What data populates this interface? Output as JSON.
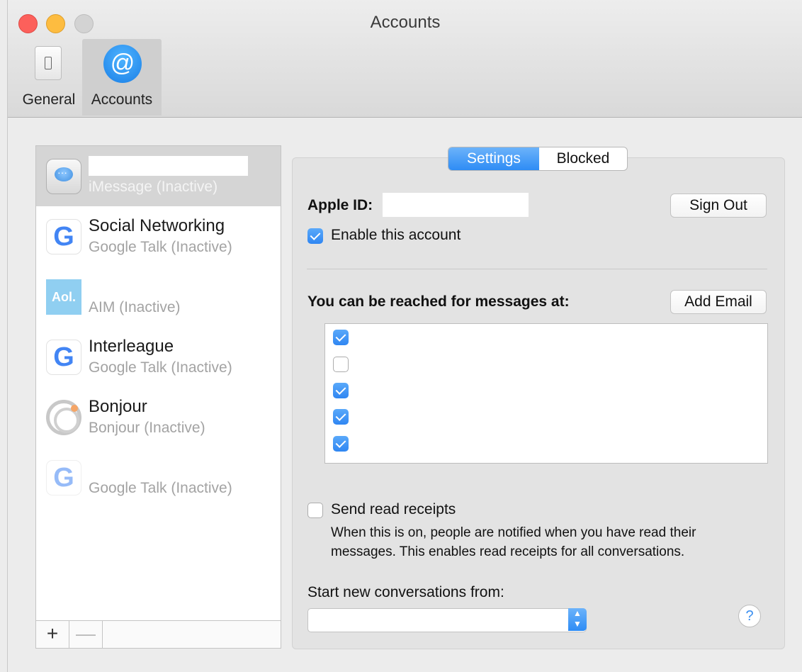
{
  "window": {
    "title": "Accounts"
  },
  "toolbar": {
    "general_label": "General",
    "accounts_label": "Accounts",
    "accounts_icon_glyph": "@"
  },
  "accounts": [
    {
      "name": "",
      "subtitle": "iMessage (Inactive)",
      "icon": "messages-icon",
      "selected": true
    },
    {
      "name": "Social Networking",
      "subtitle": "Google Talk (Inactive)",
      "icon": "google-icon"
    },
    {
      "name": "",
      "subtitle": "AIM (Inactive)",
      "icon": "aol-icon"
    },
    {
      "name": "Interleague",
      "subtitle": "Google Talk (Inactive)",
      "icon": "google-icon"
    },
    {
      "name": "Bonjour",
      "subtitle": "Bonjour (Inactive)",
      "icon": "bonjour-icon"
    },
    {
      "name": "",
      "subtitle": "Google Talk (Inactive)",
      "icon": "google-icon"
    }
  ],
  "icon_text": {
    "google": "G",
    "aol": "Aol."
  },
  "sidebar_footer": {
    "add": "+",
    "remove": "—"
  },
  "tabs": {
    "settings": "Settings",
    "blocked": "Blocked"
  },
  "settings": {
    "apple_id_label": "Apple ID:",
    "sign_out": "Sign Out",
    "enable_account": "Enable this account",
    "enable_checked": true,
    "reach_label": "You can be reached for messages at:",
    "add_email": "Add Email",
    "addresses_checked": [
      true,
      false,
      true,
      true,
      true
    ],
    "read_receipts_label": "Send read receipts",
    "read_receipts_checked": false,
    "read_receipts_desc_1": "When this is on, people are notified when you have read their",
    "read_receipts_desc_2": "messages. This enables read receipts for all conversations.",
    "start_from_label": "Start new conversations from:",
    "start_from_value": "",
    "help": "?"
  },
  "colors": {
    "accent": "#2e8cf5",
    "close": "#fc605b",
    "minimize": "#fdbc40"
  }
}
